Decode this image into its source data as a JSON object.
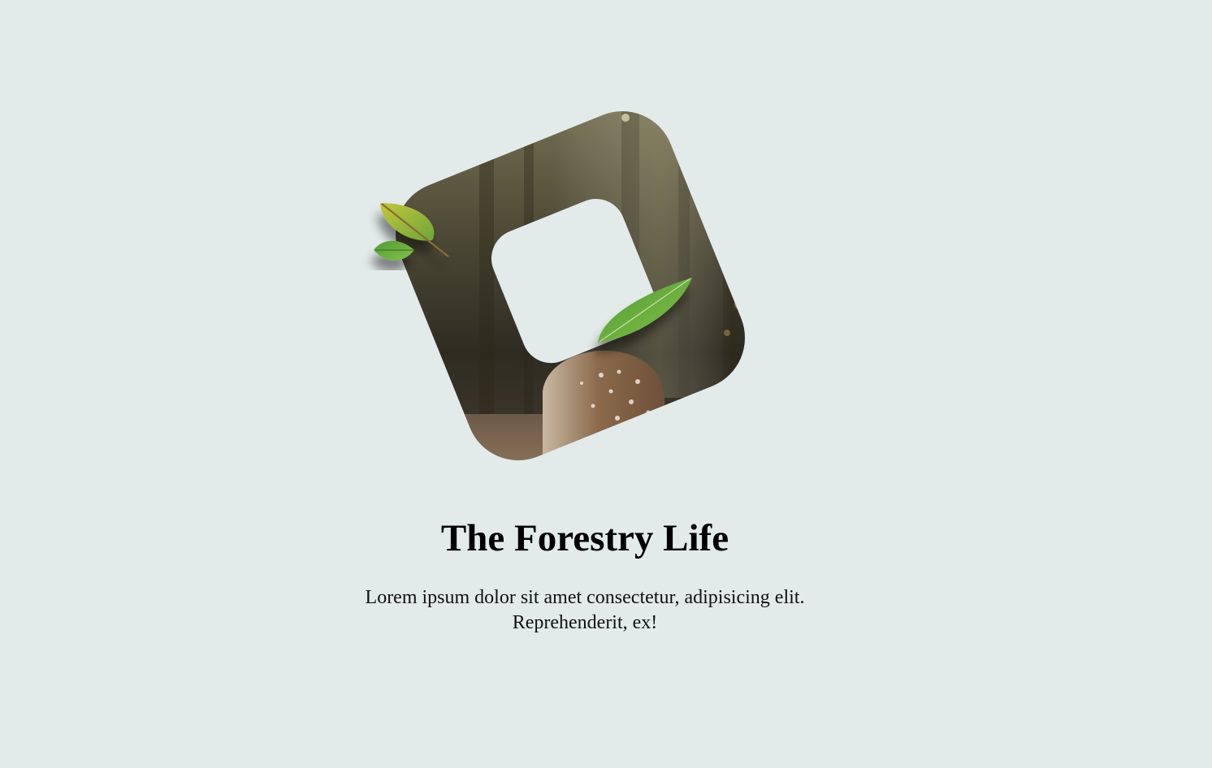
{
  "hero": {
    "image_subject": "fawn in forest",
    "decorations": [
      "leaf-icon",
      "leaf-icon",
      "leaf-icon"
    ]
  },
  "title": "The Forestry Life",
  "description": "Lorem ipsum dolor sit amet consectetur, adipisicing elit. Reprehenderit, ex!",
  "colors": {
    "background": "#e3eaea",
    "text": "#000000",
    "leaf_green": "#5fa83a",
    "leaf_yellow": "#b5c23a"
  }
}
